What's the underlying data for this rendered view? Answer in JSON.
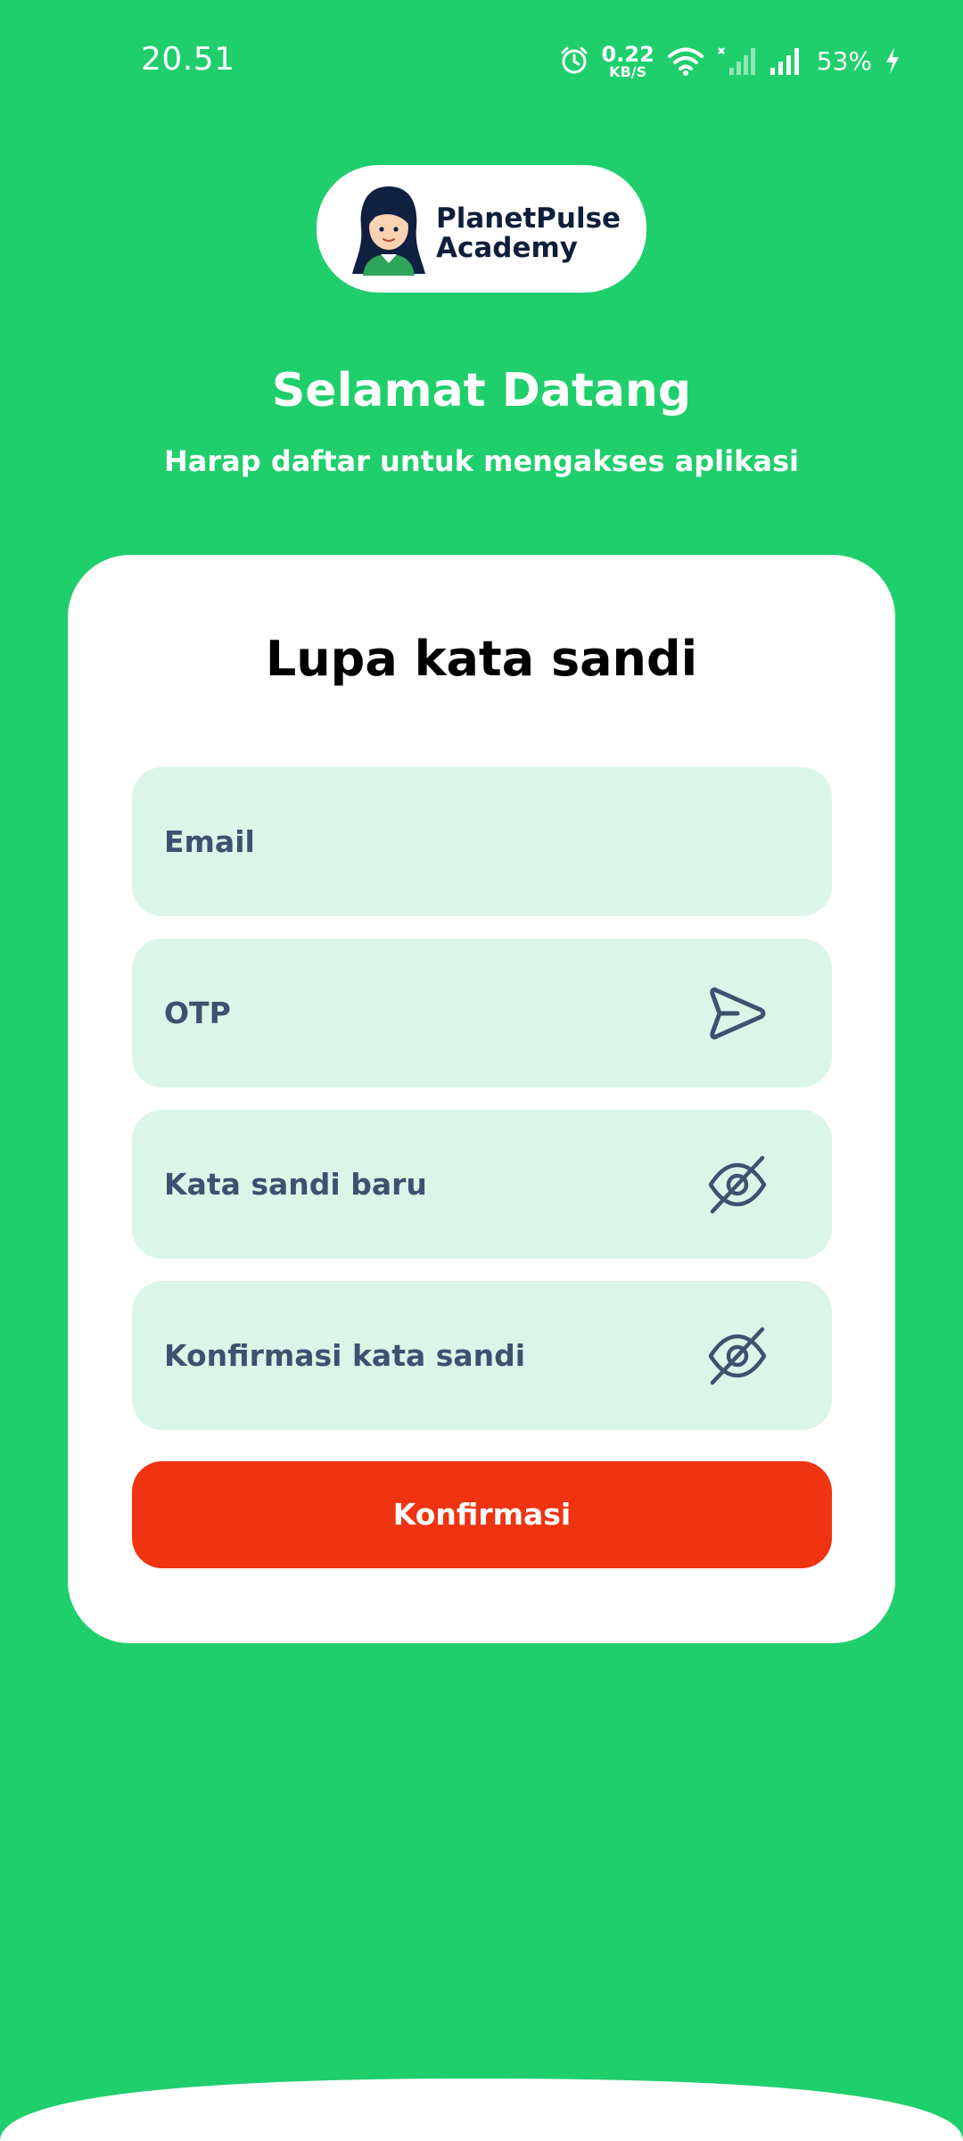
{
  "status_bar": {
    "time": "20.51",
    "speed_value": "0.22",
    "speed_unit": "KB/S",
    "battery": "53%"
  },
  "logo": {
    "line1": "PlanetPulse",
    "line2": "Academy"
  },
  "welcome": {
    "title": "Selamat Datang",
    "subtitle": "Harap daftar untuk mengakses aplikasi"
  },
  "card": {
    "title": "Lupa kata sandi",
    "fields": [
      {
        "label": "Email"
      },
      {
        "label": "OTP",
        "icon": "send-icon"
      },
      {
        "label": "Kata sandi baru",
        "icon": "eye-off-icon"
      },
      {
        "label": "Konfirmasi kata sandi",
        "icon": "eye-off-icon"
      }
    ],
    "confirm_label": "Konfirmasi"
  },
  "colors": {
    "background": "#1fcf6c",
    "field_bg": "#dbf6e8",
    "button": "#f03311",
    "field_text": "#3d5170"
  }
}
